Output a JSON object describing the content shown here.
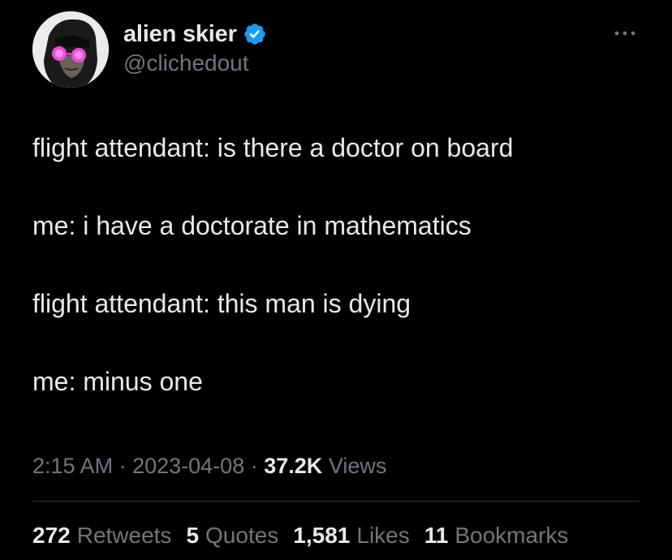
{
  "colors": {
    "background": "#000000",
    "text_primary": "#e7e9ea",
    "text_secondary": "#71767b",
    "verified_badge": "#1d9bf0",
    "divider": "#2f3336"
  },
  "icons": {
    "verified": "verified-badge-icon",
    "more": "more-horizontal-icon"
  },
  "author": {
    "display_name": "alien skier",
    "handle": "@clichedout"
  },
  "tweet": {
    "lines": [
      "flight attendant: is there a doctor on board",
      "me: i have a doctorate in mathematics",
      "flight attendant: this man is dying",
      "me: minus one"
    ]
  },
  "meta": {
    "time": "2:15 AM",
    "date": "2023-04-08",
    "separator": "·",
    "views_count": "37.2K",
    "views_label": "Views"
  },
  "stats": [
    {
      "count": "272",
      "label": "Retweets"
    },
    {
      "count": "5",
      "label": "Quotes"
    },
    {
      "count": "1,581",
      "label": "Likes"
    },
    {
      "count": "11",
      "label": "Bookmarks"
    }
  ]
}
